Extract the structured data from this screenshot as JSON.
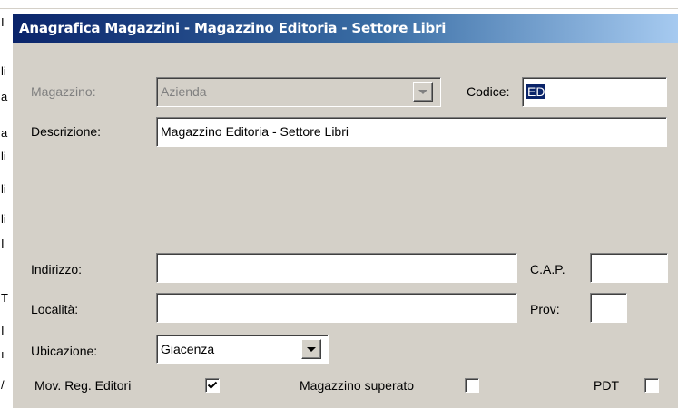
{
  "background_fragments": [
    "I",
    "li",
    "a",
    "a",
    "li",
    "li",
    "li",
    "I",
    "T",
    "I",
    "ı",
    "/"
  ],
  "dialog": {
    "title": "Anagrafica Magazzini - Magazzino Editoria - Settore Libri"
  },
  "form": {
    "magazzino": {
      "label": "Magazzino:",
      "value": "Azienda",
      "enabled": false
    },
    "codice": {
      "label": "Codice:",
      "value": "ED"
    },
    "descrizione": {
      "label": "Descrizione:",
      "value": "Magazzino Editoria - Settore Libri"
    },
    "indirizzo": {
      "label": "Indirizzo:",
      "value": ""
    },
    "cap": {
      "label": "C.A.P.",
      "value": ""
    },
    "localita": {
      "label": "Località:",
      "value": ""
    },
    "prov": {
      "label": "Prov:",
      "value": ""
    },
    "ubicazione": {
      "label": "Ubicazione:",
      "value": "Giacenza"
    },
    "checks": [
      {
        "label": "Mov. Reg. Editori",
        "checked": true
      },
      {
        "label": "Magazzino superato",
        "checked": false
      },
      {
        "label": "PDT",
        "checked": false
      }
    ]
  },
  "icons": {
    "dropdown": "chevron-down-icon",
    "check": "checkmark-icon"
  }
}
